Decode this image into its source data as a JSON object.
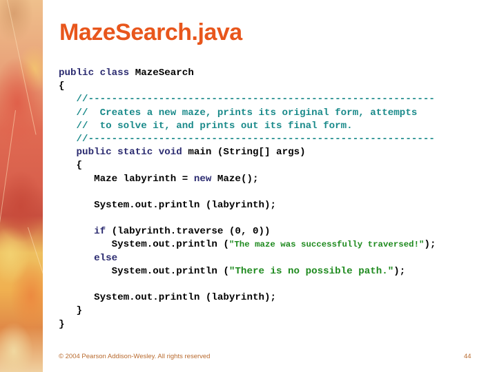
{
  "slide": {
    "title": "MazeSearch.java",
    "footer": "© 2004 Pearson Addison-Wesley. All rights reserved",
    "page_number": "44",
    "colors": {
      "title": "#e8561c",
      "keyword": "#2b2b70",
      "comment": "#1a8a8a",
      "string": "#1e8a1e",
      "footer": "#b86a2e"
    }
  },
  "code": {
    "l1": {
      "kw1": "public",
      "kw2": "class",
      "rest": " MazeSearch"
    },
    "l2": {
      "text": "{"
    },
    "l3": {
      "comment": "   //-----------------------------------------------------------"
    },
    "l4": {
      "comment": "   //  Creates a new maze, prints its original form, attempts"
    },
    "l5": {
      "comment": "   //  to solve it, and prints out its final form."
    },
    "l6": {
      "comment": "   //-----------------------------------------------------------"
    },
    "l7": {
      "indent": "   ",
      "kw1": "public",
      "kw2": "static",
      "kw3": "void",
      "rest": " main (String[] args)"
    },
    "l8": {
      "text": "   {"
    },
    "l9": {
      "pre": "      Maze labyrinth = ",
      "kw": "new",
      "post": " Maze();"
    },
    "l10": {
      "text": ""
    },
    "l11": {
      "text": "      System.out.println (labyrinth);"
    },
    "l12": {
      "text": ""
    },
    "l13": {
      "indent": "      ",
      "kw": "if",
      "rest": " (labyrinth.traverse (0, 0))"
    },
    "l14": {
      "pre": "         System.out.println (",
      "str": "\"The maze was successfully traversed!\"",
      "post": ");"
    },
    "l15": {
      "indent": "      ",
      "kw": "else"
    },
    "l16": {
      "pre": "         System.out.println (",
      "str": "\"There is no possible path.\"",
      "post": ");"
    },
    "l17": {
      "text": ""
    },
    "l18": {
      "text": "      System.out.println (labyrinth);"
    },
    "l19": {
      "text": "   }"
    },
    "l20": {
      "text": "}"
    }
  }
}
